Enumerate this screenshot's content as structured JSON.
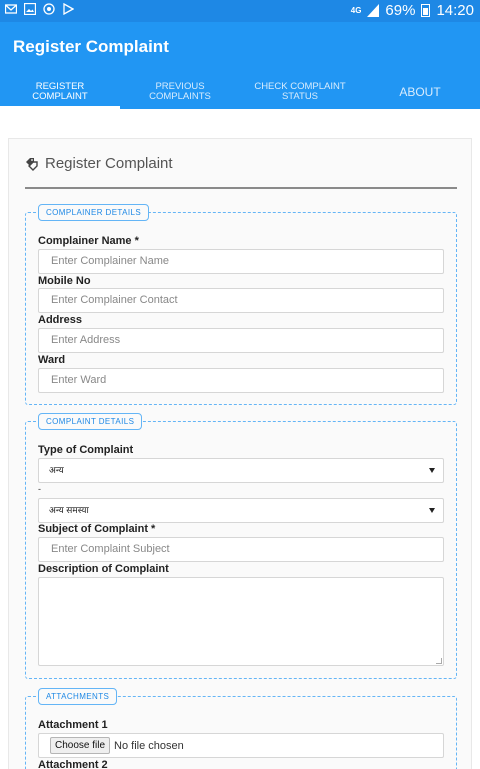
{
  "status_bar": {
    "icons": [
      "mail-icon",
      "image-icon",
      "circle-icon",
      "play-icon"
    ],
    "network": "4G",
    "battery": "69%",
    "time": "14:20"
  },
  "app_bar": {
    "title": "Register Complaint",
    "tabs": [
      {
        "label": "Register Complaint",
        "active": true
      },
      {
        "label": "Previous Complaints",
        "active": false
      },
      {
        "label": "Check Complaint Status",
        "active": false
      },
      {
        "label": "About",
        "active": false
      }
    ]
  },
  "form": {
    "heading": "Register Complaint",
    "complainer_section": {
      "legend": "Complainer Details",
      "name_label": "Complainer Name *",
      "name_placeholder": "Enter Complainer Name",
      "mobile_label": "Mobile No",
      "mobile_placeholder": "Enter Complainer Contact",
      "address_label": "Address",
      "address_placeholder": "Enter Address",
      "ward_label": "Ward",
      "ward_placeholder": "Enter Ward"
    },
    "complaint_section": {
      "legend": "Complaint Details",
      "type_label": "Type of Complaint",
      "type_value": "अन्य",
      "subtype_label": "-",
      "subtype_value": "अन्य समस्या",
      "subject_label": "Subject of Complaint *",
      "subject_placeholder": "Enter Complaint Subject",
      "description_label": "Description of Complaint"
    },
    "attachments_section": {
      "legend": "Attachments",
      "attachment1_label": "Attachment 1",
      "choose_file_label": "Choose file",
      "no_file_text": "No file chosen",
      "attachment2_label": "Attachment 2"
    }
  },
  "colors": {
    "status_bar": "#1e88e5",
    "app_bar": "#2196f3",
    "accent": "#1e88e5"
  }
}
